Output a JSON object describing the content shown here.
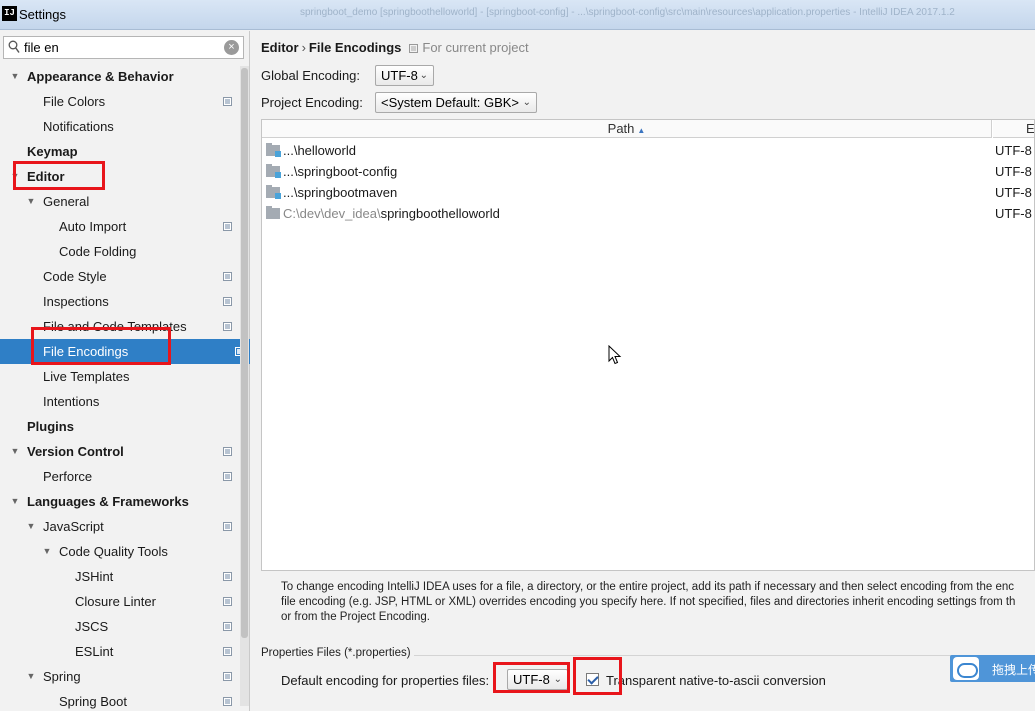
{
  "window": {
    "title": "Settings",
    "background_title": "springboot_demo [springboothelloworld] - [springboot-config] - ...\\springboot-config\\src\\main\\resources\\application.properties - IntelliJ IDEA 2017.1.2"
  },
  "search": {
    "value": "file en"
  },
  "tree": [
    {
      "label": "Appearance & Behavior",
      "bold": true,
      "arrow": "expanded",
      "project_icon": false
    },
    {
      "label": "File Colors",
      "bold": false,
      "arrow": "",
      "project_icon": true
    },
    {
      "label": "Notifications",
      "bold": false,
      "arrow": "",
      "project_icon": false
    },
    {
      "label": "Keymap",
      "bold": true,
      "arrow": "",
      "project_icon": false
    },
    {
      "label": "Editor",
      "bold": true,
      "arrow": "expanded",
      "project_icon": false
    },
    {
      "label": "General",
      "bold": false,
      "arrow": "expanded",
      "project_icon": false
    },
    {
      "label": "Auto Import",
      "bold": false,
      "arrow": "",
      "project_icon": true
    },
    {
      "label": "Code Folding",
      "bold": false,
      "arrow": "",
      "project_icon": false
    },
    {
      "label": "Code Style",
      "bold": false,
      "arrow": "",
      "project_icon": true
    },
    {
      "label": "Inspections",
      "bold": false,
      "arrow": "",
      "project_icon": true
    },
    {
      "label": "File and Code Templates",
      "bold": false,
      "arrow": "",
      "project_icon": true
    },
    {
      "label": "File Encodings",
      "bold": false,
      "arrow": "",
      "project_icon": true,
      "selected": true
    },
    {
      "label": "Live Templates",
      "bold": false,
      "arrow": "",
      "project_icon": false
    },
    {
      "label": "Intentions",
      "bold": false,
      "arrow": "",
      "project_icon": false
    },
    {
      "label": "Plugins",
      "bold": true,
      "arrow": "",
      "project_icon": false
    },
    {
      "label": "Version Control",
      "bold": true,
      "arrow": "expanded",
      "project_icon": true
    },
    {
      "label": "Perforce",
      "bold": false,
      "arrow": "",
      "project_icon": true
    },
    {
      "label": "Languages & Frameworks",
      "bold": true,
      "arrow": "expanded",
      "project_icon": false
    },
    {
      "label": "JavaScript",
      "bold": false,
      "arrow": "expanded",
      "project_icon": true
    },
    {
      "label": "Code Quality Tools",
      "bold": false,
      "arrow": "expanded",
      "project_icon": false
    },
    {
      "label": "JSHint",
      "bold": false,
      "arrow": "",
      "project_icon": true
    },
    {
      "label": "Closure Linter",
      "bold": false,
      "arrow": "",
      "project_icon": true
    },
    {
      "label": "JSCS",
      "bold": false,
      "arrow": "",
      "project_icon": true
    },
    {
      "label": "ESLint",
      "bold": false,
      "arrow": "",
      "project_icon": true
    },
    {
      "label": "Spring",
      "bold": false,
      "arrow": "expanded",
      "project_icon": true
    },
    {
      "label": "Spring Boot",
      "bold": false,
      "arrow": "",
      "project_icon": true
    }
  ],
  "breadcrumb": {
    "parent": "Editor",
    "separator": "›",
    "current": "File Encodings",
    "scope": "For current project"
  },
  "global_encoding": {
    "label": "Global Encoding:",
    "value": "UTF-8"
  },
  "project_encoding": {
    "label": "Project Encoding:",
    "value": "<System Default: GBK>"
  },
  "table": {
    "columns": [
      "Path",
      "Er"
    ],
    "rows": [
      {
        "dim": "",
        "path": "...\\helloworld",
        "encoding": "UTF-8"
      },
      {
        "dim": "",
        "path": "...\\springboot-config",
        "encoding": "UTF-8"
      },
      {
        "dim": "",
        "path": "...\\springbootmaven",
        "encoding": "UTF-8"
      },
      {
        "dim": "C:\\dev\\dev_idea\\",
        "path": "springboothelloworld",
        "encoding": "UTF-8"
      }
    ]
  },
  "info_lines": [
    "To change encoding IntelliJ IDEA uses for a file, a directory, or the entire project, add its path if necessary and then select encoding from the enc",
    "file encoding (e.g. JSP, HTML or XML) overrides encoding you specify here. If not specified, files and directories inherit encoding settings from th",
    "or from the Project Encoding."
  ],
  "properties": {
    "section_title": "Properties Files (*.properties)",
    "default_label": "Default encoding for properties files:",
    "default_value": "UTF-8",
    "transparent_label": "Transparent native-to-ascii conversion",
    "transparent_checked": true
  },
  "baidu_widget": {
    "label": "拖拽上传"
  }
}
